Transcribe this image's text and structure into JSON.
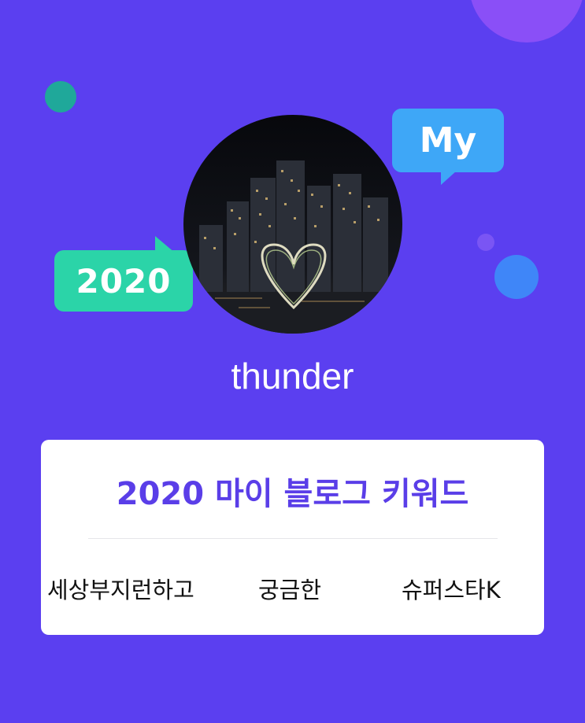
{
  "badges": {
    "year": "2020",
    "my": "My"
  },
  "profile": {
    "username": "thunder",
    "avatar_icon": "night-city-photo"
  },
  "card": {
    "title": "2020 마이 블로그 키워드",
    "keywords": [
      "세상부지런하고",
      "궁금한",
      "슈퍼스타K"
    ]
  },
  "colors": {
    "background": "#5b3ff0",
    "title": "#5a3ee8",
    "badge_green": "#2bd4a8",
    "badge_blue": "#3ea7f7"
  }
}
